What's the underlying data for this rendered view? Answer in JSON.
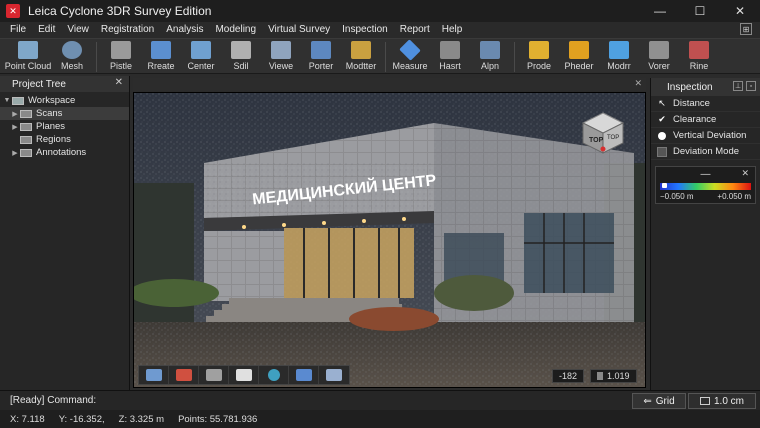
{
  "window": {
    "title": "Leica Cyclone 3DR Survey Edition",
    "logo_glyph": "✕",
    "controls": {
      "minimize": "—",
      "maximize": "☐",
      "close": "✕"
    }
  },
  "menu": [
    "File",
    "Edit",
    "View",
    "Registration",
    "Analysis",
    "Modeling",
    "Virtual Survey",
    "Inspection",
    "Report",
    "Help"
  ],
  "toolbar": {
    "items": [
      {
        "label": "Point Cloud",
        "icon": "point-cloud-icon",
        "color": "#7fa7c9"
      },
      {
        "label": "Mesh",
        "icon": "mesh-icon",
        "color": "#6f8fb0"
      },
      {
        "label": "Pistle",
        "icon": "pistle-icon",
        "color": "#9a9a9a"
      },
      {
        "label": "Rreate",
        "icon": "create-icon",
        "color": "#5b8fd0"
      },
      {
        "label": "Center",
        "icon": "center-icon",
        "color": "#6fa0d0"
      },
      {
        "label": "Sdil",
        "icon": "sdil-icon",
        "color": "#b0b0b0"
      },
      {
        "label": "Viewe",
        "icon": "view-icon",
        "color": "#8fa4be"
      },
      {
        "label": "Porter",
        "icon": "porter-icon",
        "color": "#5d88c0"
      },
      {
        "label": "Modtter",
        "icon": "modtter-icon",
        "color": "#c9a040"
      },
      {
        "label": "Measure",
        "icon": "measure-icon",
        "color": "#4f90e0"
      },
      {
        "label": "Hasrt",
        "icon": "hasrt-icon",
        "color": "#8a8a8a"
      },
      {
        "label": "Alpn",
        "icon": "align-icon",
        "color": "#6a8ab0"
      },
      {
        "label": "Prode",
        "icon": "probe-icon",
        "color": "#e0b030"
      },
      {
        "label": "Pheder",
        "icon": "pheder-icon",
        "color": "#e0a020"
      },
      {
        "label": "Modrr",
        "icon": "modrr-icon",
        "color": "#4fa0e0"
      },
      {
        "label": "Vorer",
        "icon": "vorer-icon",
        "color": "#909090"
      },
      {
        "label": "Rine",
        "icon": "rine-icon",
        "color": "#c05050"
      }
    ]
  },
  "project_tree": {
    "title": "Project Tree",
    "close": "✕",
    "items": [
      {
        "label": "Workspace",
        "level": 0,
        "arrow": "▼"
      },
      {
        "label": "Scans",
        "level": 1,
        "arrow": "▶",
        "selected": true
      },
      {
        "label": "Planes",
        "level": 1,
        "arrow": "▶"
      },
      {
        "label": "Regions",
        "level": 1,
        "arrow": ""
      },
      {
        "label": "Annotations",
        "level": 1,
        "arrow": "▶"
      }
    ]
  },
  "viewport": {
    "close": "✕",
    "sign_text": "МЕДИЦИНСКИЙ ЦЕНТР",
    "view_cube": {
      "face1": "TOP",
      "face2": "TOP"
    },
    "readout_left": "-182",
    "readout_right": "1.019",
    "tools": [
      {
        "icon": "select-icon",
        "color": "#6f9ad0"
      },
      {
        "icon": "section-icon",
        "color": "#d05040"
      },
      {
        "icon": "layers-icon",
        "color": "#a0a0a0"
      },
      {
        "icon": "clip-icon",
        "color": "#e0e0e0"
      },
      {
        "icon": "globe-icon",
        "color": "#3fa0c0"
      },
      {
        "icon": "folder-icon",
        "color": "#5a8ad0"
      },
      {
        "icon": "transform-icon",
        "color": "#9ab0d0"
      }
    ]
  },
  "inspection": {
    "title": "Inspection",
    "options": [
      {
        "label": "Distance",
        "mark": "cursor"
      },
      {
        "label": "Clearance",
        "mark": "check"
      },
      {
        "label": "Vertical Deviation",
        "mark": "dot"
      },
      {
        "label": "Deviation Mode",
        "mark": "box"
      }
    ],
    "scale": {
      "head": "—",
      "close": "✕",
      "min_label": "−0.050 m",
      "max_label": "+0.050 m"
    }
  },
  "status": {
    "command": "[Ready] Command:",
    "grid_label": "Grid",
    "grid_value": "1.0 cm",
    "x": "X: 7.118",
    "y": "Y: -16.352,",
    "z": "Z: 3.325 m",
    "points": "Points: 55.781.936"
  }
}
